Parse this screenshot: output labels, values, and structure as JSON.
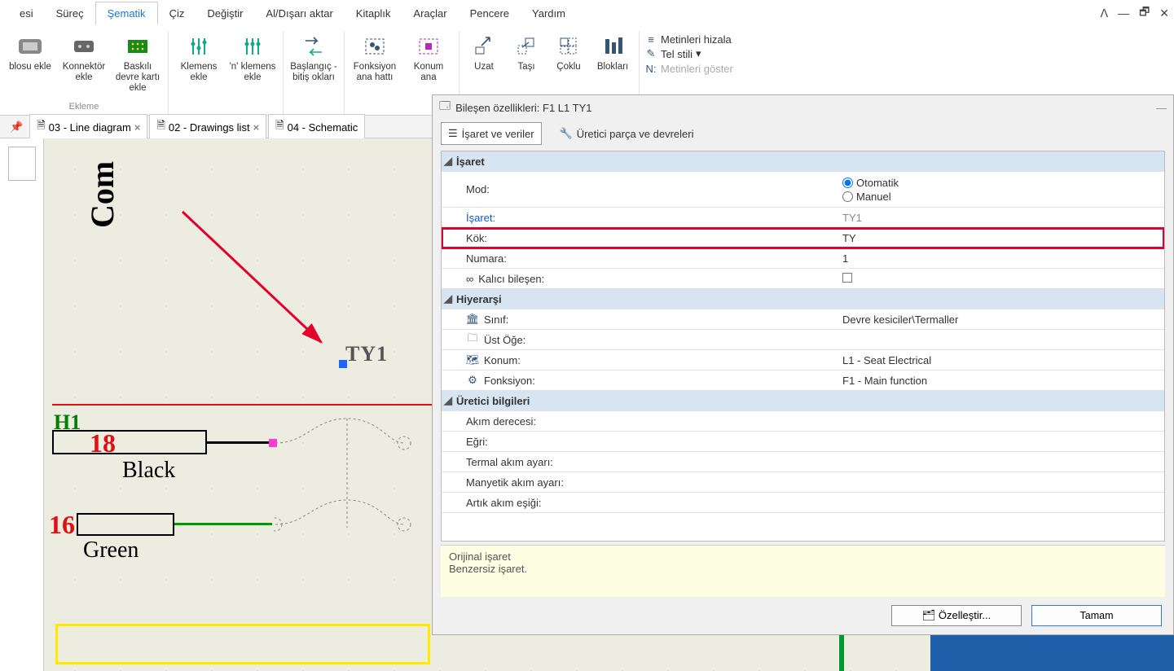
{
  "menu": {
    "tabs": [
      "esi",
      "Süreç",
      "Şematik",
      "Çiz",
      "Değiştir",
      "Al/Dışarı aktar",
      "Kitaplık",
      "Araçlar",
      "Pencere",
      "Yardım"
    ],
    "active_index": 2
  },
  "ribbon": {
    "group1_label": "Ekleme",
    "btns": [
      {
        "label": "blosu ekle"
      },
      {
        "label": "Konnektör ekle"
      },
      {
        "label": "Baskılı devre kartı ekle"
      },
      {
        "label": "Klemens ekle"
      },
      {
        "label": "'n' klemens ekle"
      },
      {
        "label": "Başlangıç - bitiş okları"
      },
      {
        "label": "Fonksiyon ana hattı"
      },
      {
        "label": "Konum ana"
      },
      {
        "label": "Uzat"
      },
      {
        "label": "Taşı"
      },
      {
        "label": "Çoklu"
      },
      {
        "label": "Blokları"
      }
    ],
    "mini": {
      "r1": "Metinleri hizala",
      "r2": "Tel stili",
      "r3": "Metinleri göster"
    }
  },
  "doc_tabs": [
    {
      "label": "03 - Line diagram"
    },
    {
      "label": "02 - Drawings list"
    },
    {
      "label": "04 - Schematic"
    }
  ],
  "canvas": {
    "com": "Com",
    "ty1": "TY1",
    "h1": "H1",
    "n18": "18",
    "black": "Black",
    "n16": "16",
    "green": "Green"
  },
  "dialog": {
    "title": "Bileşen özellikleri: F1 L1 TY1",
    "tab1": "İşaret ve veriler",
    "tab2": "Üretici parça ve devreleri",
    "sections": {
      "isaret": "İşaret",
      "hiyerarsi": "Hiyerarşi",
      "uretici": "Üretici bilgileri"
    },
    "rows": {
      "mod_label": "Mod:",
      "mod_auto": "Otomatik",
      "mod_manual": "Manuel",
      "isaret_label": "İşaret:",
      "isaret_value": "TY1",
      "kok_label": "Kök:",
      "kok_value": "TY",
      "numara_label": "Numara:",
      "numara_value": "1",
      "kalici_label": "Kalıcı bileşen:",
      "sinif_label": "Sınıf:",
      "sinif_value": "Devre kesiciler\\Termaller",
      "ust_label": "Üst Öğe:",
      "konum_label": "Konum:",
      "konum_value": "L1 - Seat Electrical",
      "fonksiyon_label": "Fonksiyon:",
      "fonksiyon_value": "F1 - Main function",
      "akim_label": "Akım derecesi:",
      "egri_label": "Eğri:",
      "termal_label": "Termal akım ayarı:",
      "manyetik_label": "Manyetik akım ayarı:",
      "artik_label": "Artık akım eşiği:"
    },
    "info1": "Orijinal işaret",
    "info2": "Benzersiz işaret.",
    "btn_custom": "Özelleştir...",
    "btn_ok": "Tamam"
  }
}
